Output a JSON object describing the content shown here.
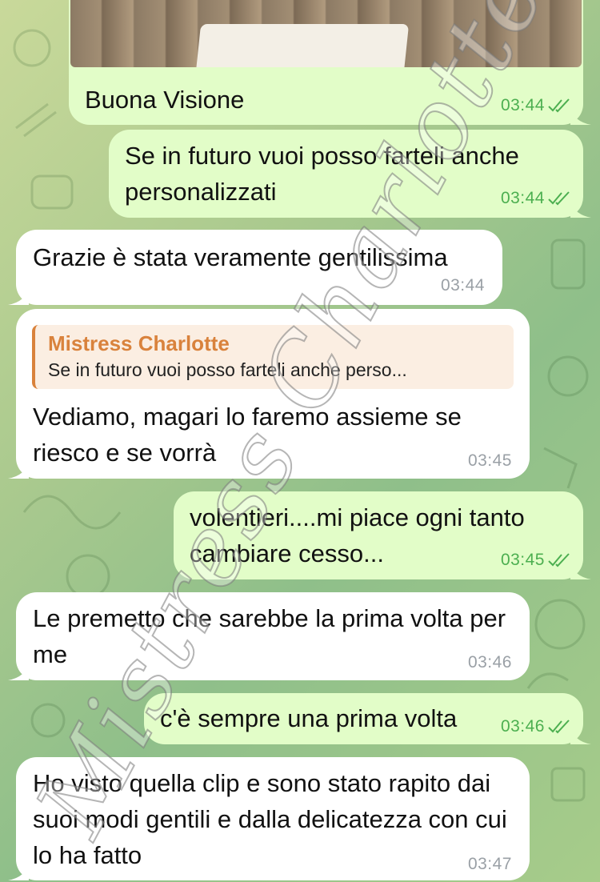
{
  "watermark": "Mistress Charlotte",
  "messages": [
    {
      "dir": "out",
      "text": "Buona Visione",
      "time": "03:44",
      "has_photo": true
    },
    {
      "dir": "out",
      "text": "Se in futuro vuoi posso farteli anche personalizzati",
      "time": "03:44"
    },
    {
      "dir": "in",
      "text": "Grazie è stata veramente gentilissima",
      "time": "03:44"
    },
    {
      "dir": "in",
      "reply": {
        "name": "Mistress Charlotte",
        "text": "Se in futuro vuoi posso farteli anche perso..."
      },
      "text": "Vediamo, magari lo faremo assieme se riesco e se vorrà",
      "time": "03:45"
    },
    {
      "dir": "out",
      "text": "volentieri....mi piace ogni tanto cambiare cesso...",
      "time": "03:45"
    },
    {
      "dir": "in",
      "text": "Le premetto che sarebbe la prima volta per me",
      "time": "03:46"
    },
    {
      "dir": "out",
      "text": "c'è sempre una prima volta",
      "time": "03:46"
    },
    {
      "dir": "in",
      "text": "Ho visto quella clip e sono stato rapito dai suoi modi gentili e dalla delicatezza con cui lo ha fatto",
      "time": "03:47"
    }
  ],
  "colors": {
    "outgoing": "#e2fdc8",
    "incoming": "#ffffff",
    "reply_accent": "#d9823c",
    "read_check": "#4caf50"
  },
  "icons": {
    "read_receipt": "double-check-icon"
  }
}
